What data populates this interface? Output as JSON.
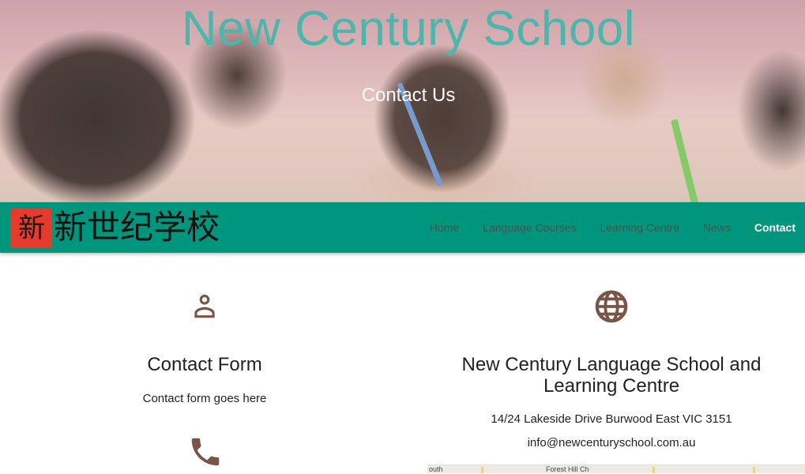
{
  "hero": {
    "title": "New Century School",
    "subtitle": "Contact Us"
  },
  "logo": {
    "seal_text": "新",
    "text": "新世纪学校"
  },
  "nav": {
    "items": [
      {
        "label": "Home",
        "active": false
      },
      {
        "label": "Language Courses",
        "active": false
      },
      {
        "label": "Learning Centre",
        "active": false
      },
      {
        "label": "News",
        "active": false
      },
      {
        "label": "Contact",
        "active": true
      }
    ]
  },
  "contact_form": {
    "icon": "person-icon",
    "title": "Contact Form",
    "body": "Contact form goes here",
    "phone_icon": "phone-icon"
  },
  "school_info": {
    "icon": "globe-icon",
    "title": "New Century Language School and Learning Centre",
    "address": "14/24 Lakeside Drive Burwood East VIC 3151",
    "email": "info@newcenturyschool.com.au",
    "map_labels": [
      "outh",
      "Forest Hill Ch"
    ]
  },
  "colors": {
    "accent": "#4db6ac",
    "navbar": "#00967e",
    "icon": "#795548"
  }
}
